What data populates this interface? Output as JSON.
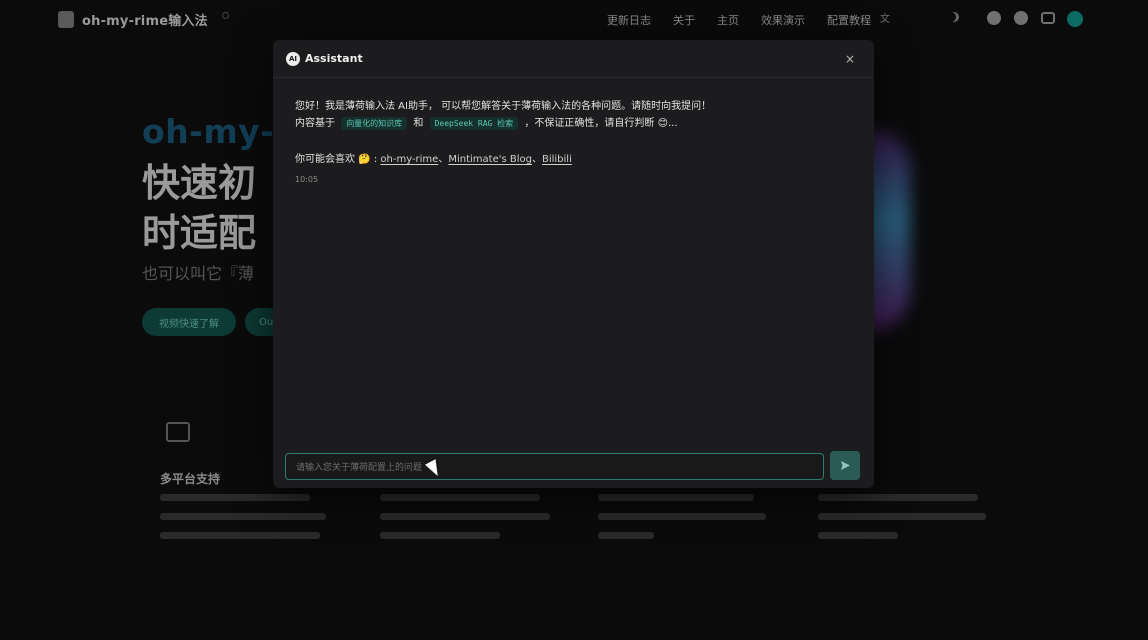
{
  "bg": {
    "brand": "oh-my-rime输入法",
    "nav": [
      "更新日志",
      "关于",
      "主页",
      "效果演示",
      "配置教程"
    ],
    "hero_sub": "oh-my-",
    "hero_line1": "快速初",
    "hero_line2": "时适配",
    "hero_tag": "也可以叫它『薄",
    "hero_btn1": "视频快速了解",
    "hero_btn2": "Ou",
    "feature_title": "多平台支持"
  },
  "modal": {
    "title": "Assistant",
    "badge": "AI",
    "close": "×",
    "intro": "您好！我是薄荷输入法 AI助手， 可以帮您解答关于薄荷输入法的各种问题。请随时向我提问！",
    "basis_prefix": "内容基于",
    "chip1": "向量化的知识库",
    "and": "和",
    "chip2": "DeepSeek RAG 检索",
    "basis_suffix": "，不保证正确性，请自行判断",
    "basis_emoji": "😊...",
    "likes_prefix": "你可能会喜欢",
    "likes_emoji": "🤔",
    "likes_colon": ":",
    "link1": "oh-my-rime",
    "sep": "、",
    "link2": "Mintimate's Blog",
    "link3": "Bilibili",
    "time": "10:05",
    "input_placeholder": "请输入您关于薄荷配置上的问题",
    "send_icon": "send-icon"
  },
  "colors": {
    "accent": "#2f7c70",
    "chip_text": "#5bc7b2"
  }
}
